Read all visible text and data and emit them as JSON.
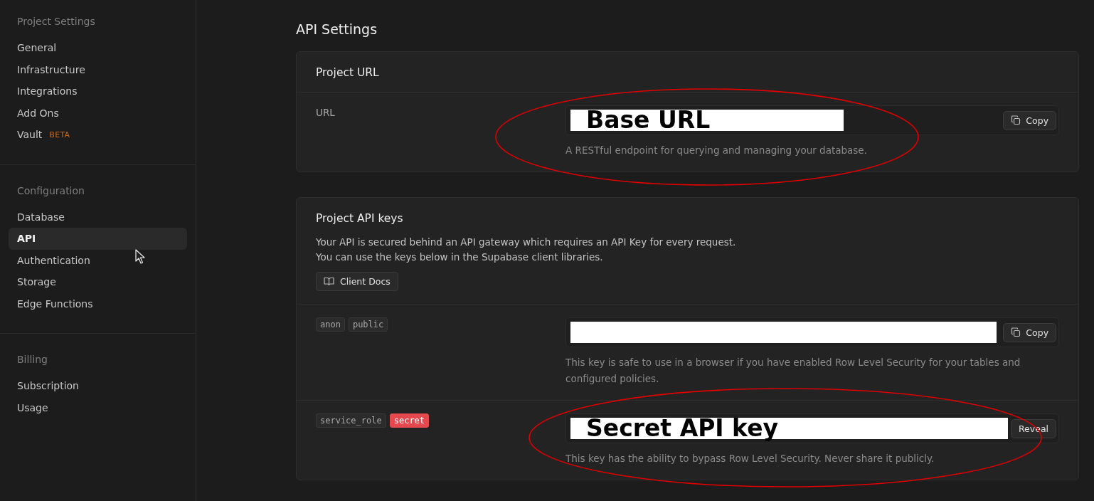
{
  "sidebar": {
    "sections": [
      {
        "title": "Project Settings",
        "items": [
          {
            "label": "General",
            "selected": false
          },
          {
            "label": "Infrastructure",
            "selected": false
          },
          {
            "label": "Integrations",
            "selected": false
          },
          {
            "label": "Add Ons",
            "selected": false
          },
          {
            "label": "Vault",
            "selected": false,
            "badge": "BETA"
          }
        ]
      },
      {
        "title": "Configuration",
        "items": [
          {
            "label": "Database",
            "selected": false
          },
          {
            "label": "API",
            "selected": true
          },
          {
            "label": "Authentication",
            "selected": false
          },
          {
            "label": "Storage",
            "selected": false
          },
          {
            "label": "Edge Functions",
            "selected": false
          }
        ]
      },
      {
        "title": "Billing",
        "items": [
          {
            "label": "Subscription",
            "selected": false
          },
          {
            "label": "Usage",
            "selected": false
          }
        ]
      }
    ]
  },
  "page_title": "API Settings",
  "url_card": {
    "title": "Project URL",
    "row": {
      "label": "URL",
      "redacted": true,
      "redaction_label": "Base URL",
      "button": "Copy",
      "help": "A RESTful endpoint for querying and managing your database.",
      "circled": true
    }
  },
  "keys_card": {
    "title": "Project API keys",
    "description": [
      "Your API is secured behind an API gateway which requires an API Key for every request.",
      "You can use the keys below in the Supabase client libraries."
    ],
    "docs_button": "Client Docs",
    "keys": [
      {
        "tags": [
          {
            "text": "anon",
            "kind": "plain"
          },
          {
            "text": "public",
            "kind": "plain"
          }
        ],
        "redacted": true,
        "button": "Copy",
        "copy_icon": true,
        "help": "This key is safe to use in a browser if you have enabled Row Level Security for your tables and configured policies.",
        "circled": false
      },
      {
        "tags": [
          {
            "text": "service_role",
            "kind": "plain"
          },
          {
            "text": "secret",
            "kind": "danger"
          }
        ],
        "redacted": true,
        "redaction_label": "Secret API key",
        "button": "Reveal",
        "copy_icon": false,
        "help": "This key has the ability to bypass Row Level Security. Never share it publicly.",
        "circled": true
      }
    ]
  }
}
